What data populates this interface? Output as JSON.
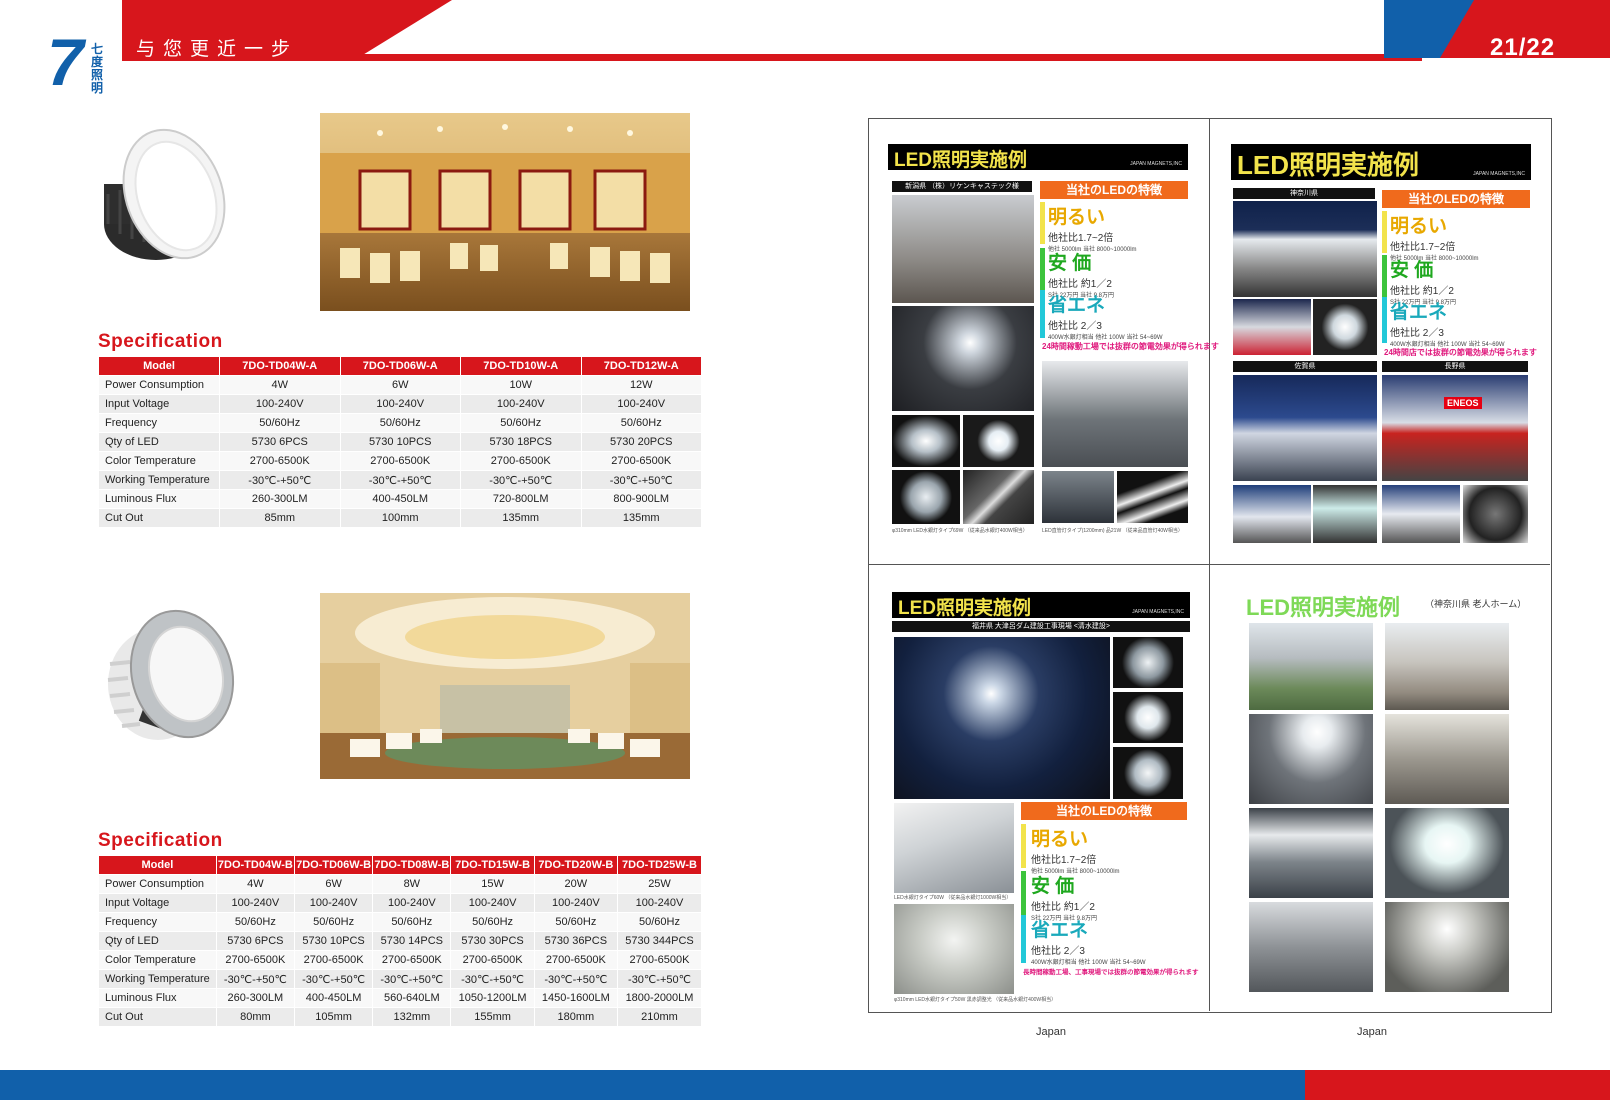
{
  "header": {
    "slogan": "与您更近一步",
    "page_number": "21/22",
    "logo_mark": "7",
    "logo_brand": "七度照明"
  },
  "spec_a": {
    "title": "Specification",
    "columns": [
      "Model",
      "7DO-TD04W-A",
      "7DO-TD06W-A",
      "7DO-TD10W-A",
      "7DO-TD12W-A"
    ],
    "rows": [
      [
        "Power Consumption",
        "4W",
        "6W",
        "10W",
        "12W"
      ],
      [
        "Input Voltage",
        "100-240V",
        "100-240V",
        "100-240V",
        "100-240V"
      ],
      [
        "Frequency",
        "50/60Hz",
        "50/60Hz",
        "50/60Hz",
        "50/60Hz"
      ],
      [
        "Qty of LED",
        "5730 6PCS",
        "5730 10PCS",
        "5730 18PCS",
        "5730 20PCS"
      ],
      [
        "Color Temperature",
        "2700-6500K",
        "2700-6500K",
        "2700-6500K",
        "2700-6500K"
      ],
      [
        "Working Temperature",
        "-30℃-+50℃",
        "-30℃-+50℃",
        "-30℃-+50℃",
        "-30℃-+50℃"
      ],
      [
        "Luminous Flux",
        "260-300LM",
        "400-450LM",
        "720-800LM",
        "800-900LM"
      ],
      [
        "Cut Out",
        "85mm",
        "100mm",
        "135mm",
        "135mm"
      ]
    ]
  },
  "spec_b": {
    "title": "Specification",
    "columns": [
      "Model",
      "7DO-TD04W-B",
      "7DO-TD06W-B",
      "7DO-TD08W-B",
      "7DO-TD15W-B",
      "7DO-TD20W-B",
      "7DO-TD25W-B"
    ],
    "rows": [
      [
        "Power Consumption",
        "4W",
        "6W",
        "8W",
        "15W",
        "20W",
        "25W"
      ],
      [
        "Input Voltage",
        "100-240V",
        "100-240V",
        "100-240V",
        "100-240V",
        "100-240V",
        "100-240V"
      ],
      [
        "Frequency",
        "50/60Hz",
        "50/60Hz",
        "50/60Hz",
        "50/60Hz",
        "50/60Hz",
        "50/60Hz"
      ],
      [
        "Qty of LED",
        "5730 6PCS",
        "5730 10PCS",
        "5730 14PCS",
        "5730 30PCS",
        "5730 36PCS",
        "5730 344PCS"
      ],
      [
        "Color Temperature",
        "2700-6500K",
        "2700-6500K",
        "2700-6500K",
        "2700-6500K",
        "2700-6500K",
        "2700-6500K"
      ],
      [
        "Working Temperature",
        "-30℃-+50℃",
        "-30℃-+50℃",
        "-30℃-+50℃",
        "-30℃-+50℃",
        "-30℃-+50℃",
        "-30℃-+50℃"
      ],
      [
        "Luminous Flux",
        "260-300LM",
        "400-450LM",
        "560-640LM",
        "1050-1200LM",
        "1450-1600LM",
        "1800-2000LM"
      ],
      [
        "Cut Out",
        "80mm",
        "105mm",
        "132mm",
        "155mm",
        "180mm",
        "210mm"
      ]
    ]
  },
  "panels": {
    "p1": {
      "title": "LED照明実施例",
      "company": "JAPAN MAGNETS,INC",
      "location": "新潟県 （株）リケンキャステック様",
      "feature_head": "当社のLEDの特徴",
      "f1_big": "明るい",
      "f1_sub": "他社比1.7~2倍",
      "f1_tiny": "他社 5000lm 当社 8000~10000lm",
      "f2_big": "安 価",
      "f2_sub": "他社比 約1／2",
      "f2_tiny": "S社 22万円 当社 9.8万円",
      "f3_big": "省エネ",
      "f3_sub": "他社比 2／3",
      "f3_tiny": "400W水銀灯相当 他社 100W 当社 54~69W",
      "note": "24時間稼動工場では抜群の節電効果が得られます",
      "cap_left": "φ310mm LED水銀灯タイプ69W （従来品水銀灯400W相当）",
      "cap_right": "LED直管灯タイプ(1200mm) 品21W （従来品直管灯40W相当）"
    },
    "p2": {
      "title": "LED照明実施例",
      "company": "JAPAN MAGNETS,INC",
      "loc1": "神奈川県",
      "loc2": "佐賀県",
      "loc3": "長野県",
      "feature_head": "当社のLEDの特徴",
      "f1_big": "明るい",
      "f1_sub": "他社比1.7~2倍",
      "f1_tiny": "他社 5000lm 当社 8000~10000lm",
      "f2_big": "安 価",
      "f2_sub": "他社比 約1／2",
      "f2_tiny": "S社 22万円 当社 9.8万円",
      "f3_big": "省エネ",
      "f3_sub": "他社比 2／3",
      "f3_tiny": "400W水銀灯相当 他社 100W 当社 54~69W",
      "note": "24時間店では抜群の節電効果が得られます",
      "sign": "ENEOS"
    },
    "p3": {
      "title": "LED照明実施例",
      "company": "JAPAN MAGNETS,INC",
      "location": "福井県 大津呂ダム建設工事現場 <清水建設>",
      "feature_head": "当社のLEDの特徴",
      "f1_big": "明るい",
      "f1_sub": "他社比1.7~2倍",
      "f1_tiny": "他社 5000lm 当社 8000~10000lm",
      "f2_big": "安 価",
      "f2_sub": "他社比 約1／2",
      "f2_tiny": "S社 22万円 当社 9.8万円",
      "f3_big": "省エネ",
      "f3_sub": "他社比 2／3",
      "f3_tiny": "400W水銀灯相当 他社 100W 当社 54~69W",
      "note": "長時間稼動工場、工事現場では抜群の節電効果が得られます",
      "cap1": "LED水銀灯タイプ60W （従来品水銀灯1000W相当）",
      "cap2": "φ310mm LED水銀灯タイプ50W 黒赤調整光 （従来品水銀灯400W相当）"
    },
    "p4": {
      "title": "LED照明実施例",
      "subtitle": "（神奈川県 老人ホーム）"
    }
  },
  "japan_labels": [
    "Japan",
    "Japan"
  ],
  "colors": {
    "red": "#d7161c",
    "blue": "#1160aa",
    "orange": "#f06a1c",
    "yellow": "#f2e34b"
  }
}
